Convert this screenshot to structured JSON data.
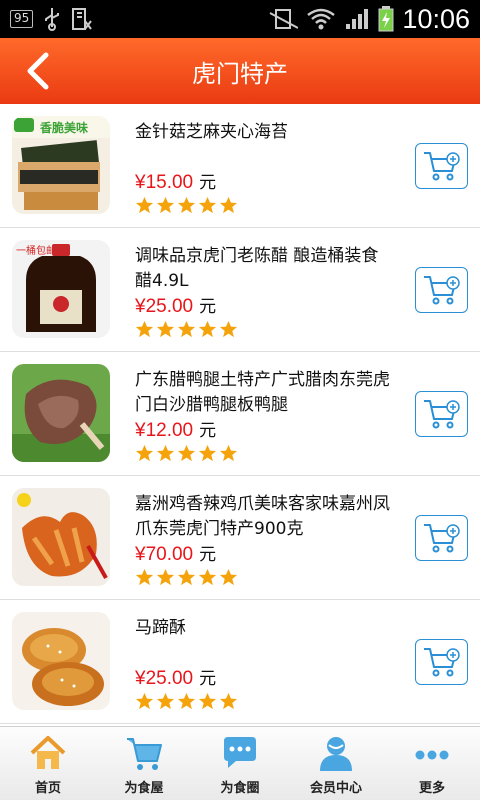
{
  "status_bar": {
    "badge": "95",
    "time": "10:06"
  },
  "header": {
    "title": "虎门特产"
  },
  "products": [
    {
      "name": "金针菇芝麻夹心海苔",
      "price": "¥15.00",
      "unit": "元",
      "rating": 5,
      "thumb_label": "香脆美味"
    },
    {
      "name": "调味品京虎门老陈醋 酿造桶装食醋4.9L",
      "price": "¥25.00",
      "unit": "元",
      "rating": 5,
      "thumb_label": "一桶包邮"
    },
    {
      "name": "广东腊鸭腿土特产广式腊肉东莞虎门白沙腊鸭腿板鸭腿",
      "price": "¥12.00",
      "unit": "元",
      "rating": 5,
      "thumb_label": ""
    },
    {
      "name": "嘉洲鸡香辣鸡爪美味客家味嘉州凤爪东莞虎门特产900克",
      "price": "¥70.00",
      "unit": "元",
      "rating": 5,
      "thumb_label": ""
    },
    {
      "name": "马蹄酥",
      "price": "¥25.00",
      "unit": "元",
      "rating": 5,
      "thumb_label": ""
    }
  ],
  "tabs": [
    {
      "label": "首页",
      "icon": "home-icon"
    },
    {
      "label": "为食屋",
      "icon": "cart-icon"
    },
    {
      "label": "为食圈",
      "icon": "chat-icon"
    },
    {
      "label": "会员中心",
      "icon": "member-icon"
    },
    {
      "label": "更多",
      "icon": "more-icon"
    }
  ],
  "colors": {
    "header": "#ee4a1a",
    "price": "#e8161b",
    "cart_border": "#2a8fd6",
    "star": "#f5a30a"
  }
}
